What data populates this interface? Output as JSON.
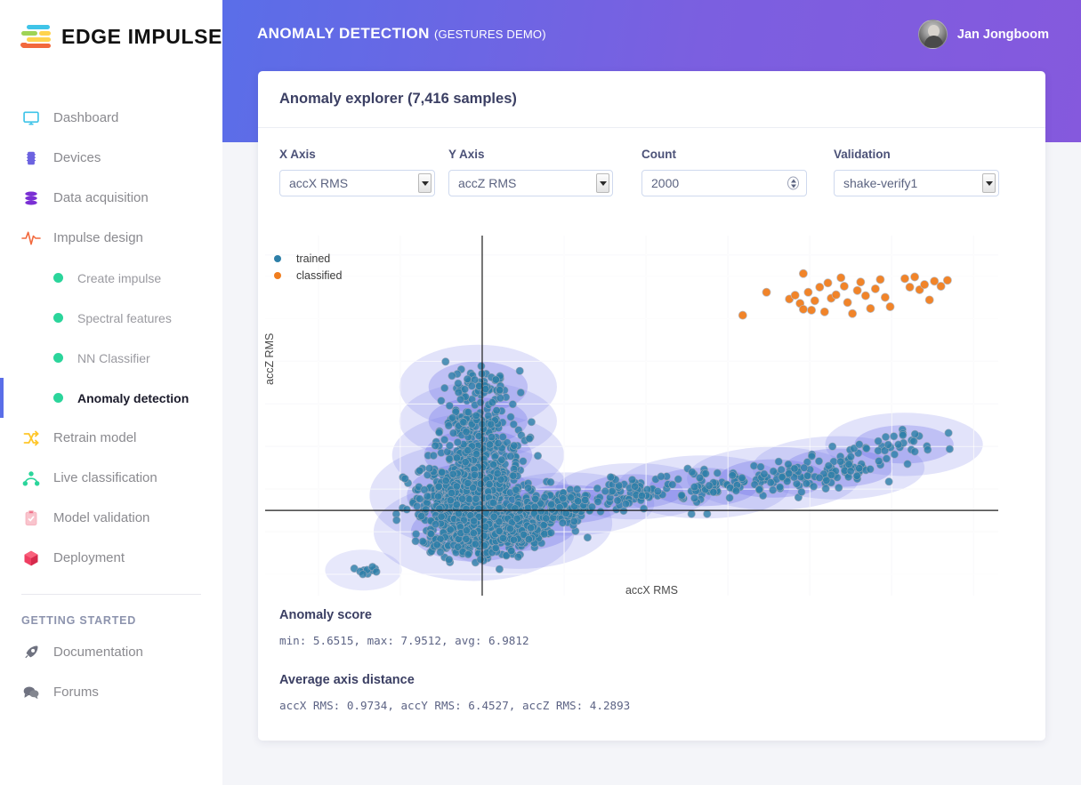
{
  "brand": {
    "name": "EDGE IMPULSE",
    "logo_icon": "edge-impulse-logo-icon"
  },
  "sidebar": {
    "items": [
      {
        "label": "Dashboard",
        "icon": "monitor-icon"
      },
      {
        "label": "Devices",
        "icon": "chip-icon"
      },
      {
        "label": "Data acquisition",
        "icon": "database-icon"
      },
      {
        "label": "Impulse design",
        "icon": "pulse-icon"
      }
    ],
    "sub_items": [
      {
        "label": "Create impulse",
        "active": false
      },
      {
        "label": "Spectral features",
        "active": false
      },
      {
        "label": "NN Classifier",
        "active": false
      },
      {
        "label": "Anomaly detection",
        "active": true
      }
    ],
    "items2": [
      {
        "label": "Retrain model",
        "icon": "shuffle-icon"
      },
      {
        "label": "Live classification",
        "icon": "network-icon"
      },
      {
        "label": "Model validation",
        "icon": "clipboard-check-icon"
      },
      {
        "label": "Deployment",
        "icon": "box-icon"
      }
    ],
    "section_title": "GETTING STARTED",
    "items3": [
      {
        "label": "Documentation",
        "icon": "rocket-icon"
      },
      {
        "label": "Forums",
        "icon": "chat-icon"
      }
    ]
  },
  "header": {
    "title": "ANOMALY DETECTION",
    "subtitle": "(GESTURES DEMO)",
    "user_name": "Jan Jongboom",
    "avatar_icon": "user-avatar"
  },
  "card": {
    "title": "Anomaly explorer (7,416 samples)"
  },
  "controls": {
    "x_axis": {
      "label": "X Axis",
      "value": "accX RMS"
    },
    "y_axis": {
      "label": "Y Axis",
      "value": "accZ RMS"
    },
    "count": {
      "label": "Count",
      "value": "2000"
    },
    "validation": {
      "label": "Validation",
      "value": "shake-verify1"
    }
  },
  "stats": {
    "anomaly_score_heading": "Anomaly score",
    "anomaly_score_value": "min: 5.6515, max: 7.9512, avg: 6.9812",
    "axis_distance_heading": "Average axis distance",
    "axis_distance_value": "accX RMS: 0.9734, accY RMS: 6.4527, accZ RMS: 4.2893"
  },
  "colors": {
    "accent": "#5a6ee8",
    "trained": "#2d7fa8",
    "classified": "#f07d1e",
    "cluster": "#6b6ee8",
    "green_dot": "#2bd59b"
  },
  "chart_data": {
    "type": "scatter",
    "title": "Anomaly explorer (7,416 samples)",
    "xlabel": "accX RMS",
    "ylabel": "accZ RMS",
    "grid": true,
    "legend_position": "top-left",
    "legend": [
      {
        "name": "trained",
        "color": "#2d7fa8"
      },
      {
        "name": "classified",
        "color": "#f07d1e"
      }
    ],
    "xlim": [
      -2.65,
      6.3
    ],
    "ylim": [
      -2.0,
      6.45
    ],
    "x_gridlines": [
      -2.0,
      -1.0,
      0.0,
      1.0,
      2.0,
      3.0,
      4.0,
      5.0,
      6.0
    ],
    "y_gridlines": [
      -1.5,
      -0.5,
      0.5,
      1.5,
      2.5,
      3.5,
      4.5,
      5.5,
      6.0
    ],
    "x_axis_zero": 0.0,
    "y_axis_zero": 0.0,
    "series": [
      {
        "name": "trained",
        "color": "#2d7fa8",
        "count": 2000,
        "description": "Dense L-shaped training cluster: a tall vertical arm near accX RMS ~ -0.05 extending upward to accZ RMS ~ 3.5, and a horizontal arm extending right to accX RMS ~ 5.5 around accZ RMS ~ 0.2 to 1.4",
        "clusters": [
          {
            "cx": -0.05,
            "cy": 2.9,
            "rx": 0.55,
            "ry": 0.6,
            "n": 60
          },
          {
            "cx": -0.05,
            "cy": 2.1,
            "rx": 0.55,
            "ry": 0.55,
            "n": 90
          },
          {
            "cx": -0.05,
            "cy": 1.3,
            "rx": 0.6,
            "ry": 0.6,
            "n": 160
          },
          {
            "cx": -0.15,
            "cy": 0.35,
            "rx": 0.7,
            "ry": 0.75,
            "n": 620
          },
          {
            "cx": -0.1,
            "cy": -0.5,
            "rx": 0.7,
            "ry": 0.7,
            "n": 430
          },
          {
            "cx": 0.45,
            "cy": -0.3,
            "rx": 0.65,
            "ry": 0.65,
            "n": 240
          },
          {
            "cx": 1.05,
            "cy": 0.15,
            "rx": 0.6,
            "ry": 0.45,
            "n": 120
          },
          {
            "cx": 1.85,
            "cy": 0.45,
            "rx": 0.55,
            "ry": 0.4,
            "n": 60
          },
          {
            "cx": 2.7,
            "cy": 0.55,
            "rx": 0.6,
            "ry": 0.45,
            "n": 60
          },
          {
            "cx": 3.55,
            "cy": 0.75,
            "rx": 0.6,
            "ry": 0.45,
            "n": 60
          },
          {
            "cx": 4.35,
            "cy": 1.0,
            "rx": 0.6,
            "ry": 0.45,
            "n": 60
          },
          {
            "cx": 5.15,
            "cy": 1.55,
            "rx": 0.55,
            "ry": 0.45,
            "n": 30
          },
          {
            "cx": -1.45,
            "cy": -1.4,
            "rx": 0.18,
            "ry": 0.2,
            "n": 10
          }
        ]
      },
      {
        "name": "classified",
        "color": "#f07d1e",
        "count": 36,
        "description": "Anomalous shake-verify1 points, isolated far from training distribution in the upper-right region",
        "points": [
          [
            3.47,
            5.12
          ],
          [
            3.75,
            4.96
          ],
          [
            3.82,
            5.05
          ],
          [
            3.88,
            4.86
          ],
          [
            3.92,
            4.72
          ],
          [
            3.98,
            5.12
          ],
          [
            4.02,
            4.7
          ],
          [
            4.06,
            4.92
          ],
          [
            4.12,
            5.24
          ],
          [
            4.18,
            4.66
          ],
          [
            4.22,
            5.34
          ],
          [
            4.26,
            4.98
          ],
          [
            4.32,
            5.06
          ],
          [
            4.38,
            5.46
          ],
          [
            4.42,
            5.26
          ],
          [
            4.46,
            4.88
          ],
          [
            4.52,
            4.62
          ],
          [
            4.58,
            5.16
          ],
          [
            4.62,
            5.36
          ],
          [
            4.68,
            5.04
          ],
          [
            4.74,
            4.74
          ],
          [
            4.8,
            5.2
          ],
          [
            4.86,
            5.42
          ],
          [
            4.92,
            5.0
          ],
          [
            4.98,
            4.78
          ],
          [
            5.16,
            5.44
          ],
          [
            5.22,
            5.24
          ],
          [
            5.28,
            5.48
          ],
          [
            5.34,
            5.18
          ],
          [
            5.4,
            5.3
          ],
          [
            5.46,
            4.94
          ],
          [
            5.52,
            5.38
          ],
          [
            5.6,
            5.26
          ],
          [
            5.68,
            5.4
          ],
          [
            3.18,
            4.58
          ],
          [
            3.92,
            5.56
          ]
        ]
      }
    ],
    "anomaly_ellipses_note": "Translucent purple ellipses drawn behind trained points mark the learned cluster boundaries (K-means centroids with radius = average axis distance)."
  }
}
